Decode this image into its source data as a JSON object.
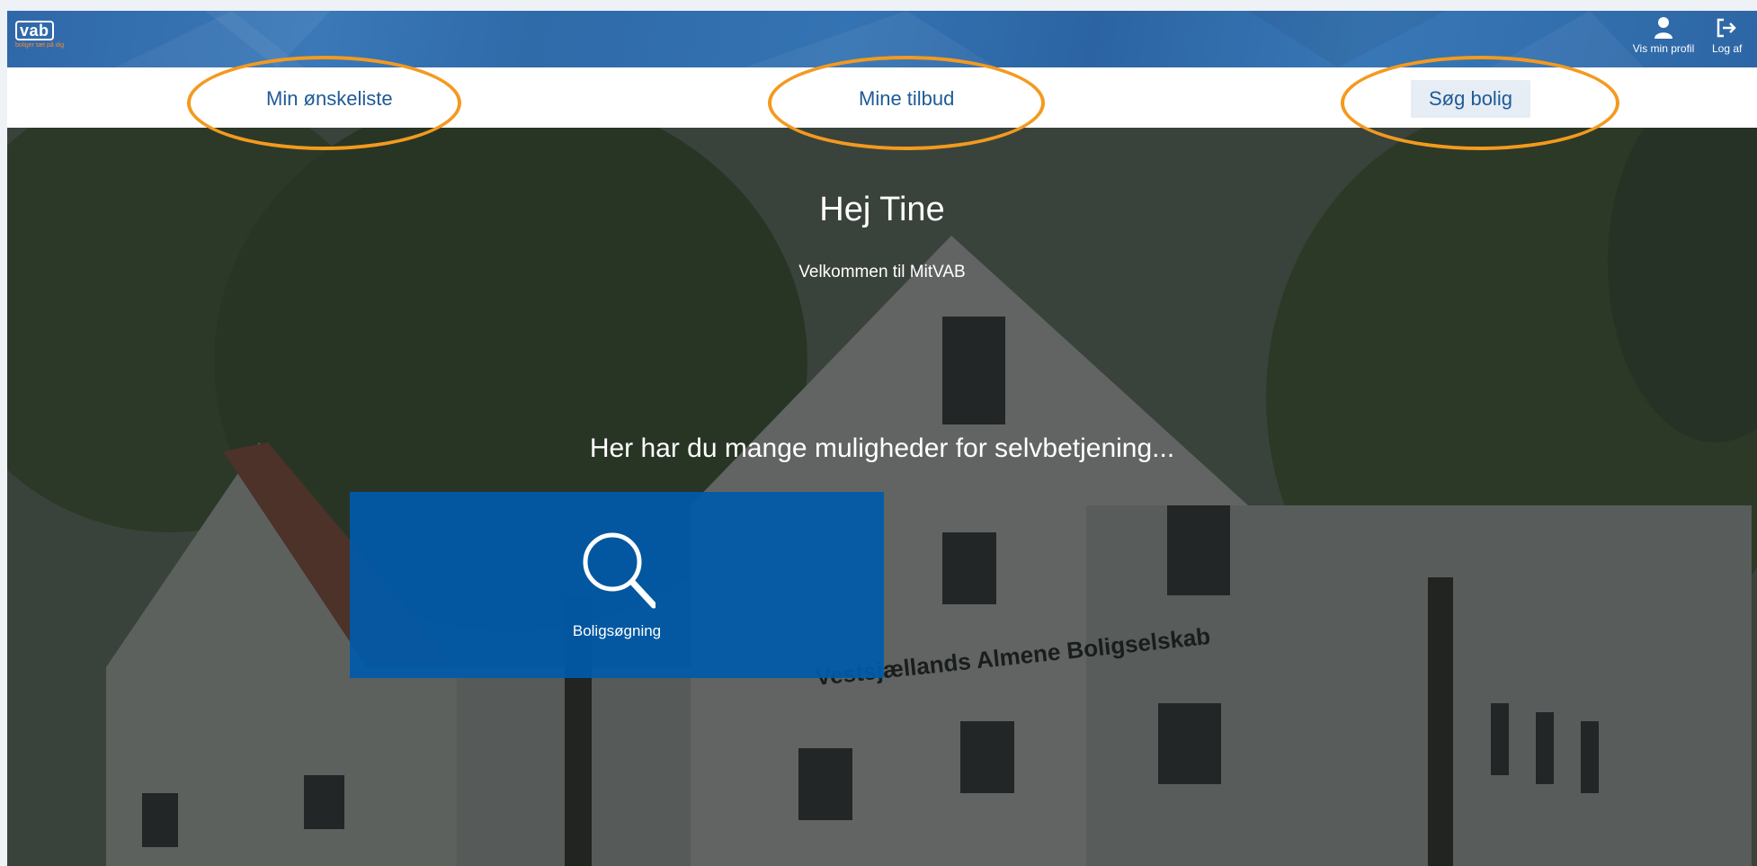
{
  "header": {
    "logo_text": "vab",
    "logo_tagline": "boliger tæt på dig",
    "profile_label": "Vis min profil",
    "logout_label": "Log af",
    "profile_icon": "user-icon",
    "logout_icon": "logout-icon"
  },
  "nav": {
    "wishlist": "Min ønskeliste",
    "offers": "Mine tilbud",
    "search": "Søg bolig"
  },
  "hero": {
    "title": "Hej Tine",
    "subtitle": "Velkommen til MitVAB",
    "lead": "Her har du mange muligheder for selvbetjening...",
    "building_sign": "Vestsjællands Almene Boligselskab"
  },
  "tiles": [
    {
      "label": "Boligsøgning",
      "icon": "search-icon"
    }
  ],
  "colors": {
    "header_blue": "#2f68a8",
    "nav_text": "#1f5a96",
    "tile_blue": "#005aaa",
    "highlight_orange": "#f39a1f",
    "logo_tag_orange": "#ef8a3a"
  }
}
